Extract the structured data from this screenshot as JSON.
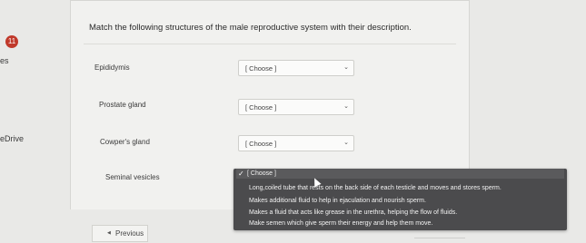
{
  "sidebar": {
    "badge": "11",
    "label_partial_1": "es",
    "label_partial_2": "eDrive"
  },
  "quiz": {
    "question": "Match the following structures of the male reproductive system with their description.",
    "rows": [
      {
        "label": "Epididymis",
        "selected": "[ Choose ]"
      },
      {
        "label": "Prostate gland",
        "selected": "[ Choose ]"
      },
      {
        "label": "Cowper's gland",
        "selected": "[ Choose ]"
      },
      {
        "label": "Seminal vesicles",
        "selected": "[ Choose ]"
      }
    ],
    "dropdown_options": [
      "[ Choose ]",
      "Long,coiled tube that rests on the back side of each testicle and moves and stores sperm.",
      "Makes additional fluid to help in ejaculation and nourish sperm.",
      "Makes a fluid that acts like grease in the urethra, helping the flow of fluids.",
      "Make semen which give sperm their energy and help them move."
    ]
  },
  "nav": {
    "previous_label": "Previous"
  }
}
